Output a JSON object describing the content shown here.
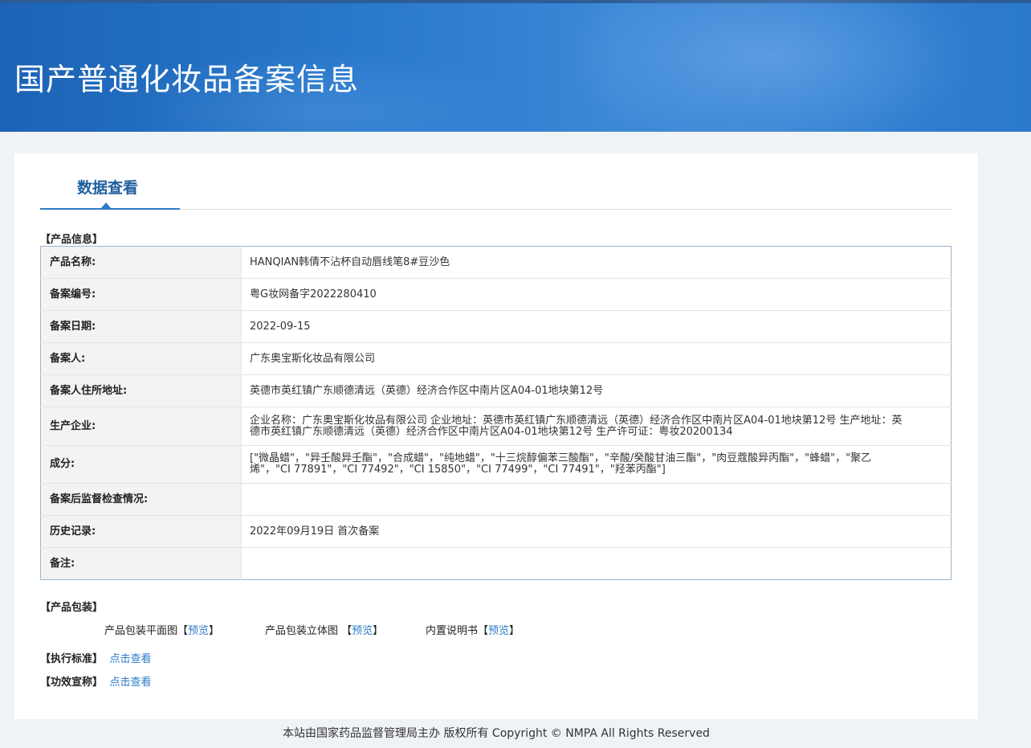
{
  "header": {
    "title": "国产普通化妆品备案信息"
  },
  "tab": {
    "label": "数据查看"
  },
  "product_info": {
    "section_title": "【产品信息】",
    "rows": [
      {
        "label": "产品名称:",
        "value": "HANQIAN韩倩不沾杯自动唇线笔8#豆沙色"
      },
      {
        "label": "备案编号:",
        "value": "粤G妆网备字2022280410"
      },
      {
        "label": "备案日期:",
        "value": "2022-09-15"
      },
      {
        "label": "备案人:",
        "value": "广东奥宝斯化妆品有限公司"
      },
      {
        "label": "备案人住所地址:",
        "value": "英德市英红镇广东顺德清远（英德）经济合作区中南片区A04-01地块第12号"
      },
      {
        "label": "生产企业:",
        "value": "企业名称：广东奥宝斯化妆品有限公司 企业地址：英德市英红镇广东顺德清远（英德）经济合作区中南片区A04-01地块第12号 生产地址：英德市英红镇广东顺德清远（英德）经济合作区中南片区A04-01地块第12号 生产许可证：粤妆20200134"
      },
      {
        "label": "成分:",
        "value": "[\"微晶蜡\"，\"异壬酸异壬酯\"，\"合成蜡\"，\"纯地蜡\"，\"十三烷醇偏苯三酸酯\"，\"辛酸/癸酸甘油三酯\"，\"肉豆蔻酸异丙酯\"，\"蜂蜡\"，\"聚乙烯\"，\"CI 77891\"，\"CI 77492\"，\"CI 15850\"，\"CI 77499\"，\"CI 77491\"，\"羟苯丙酯\"]"
      },
      {
        "label": "备案后监督检查情况:",
        "value": ""
      },
      {
        "label": "历史记录:",
        "value": "2022年09月19日 首次备案"
      },
      {
        "label": "备注:",
        "value": ""
      }
    ]
  },
  "packaging": {
    "section_title": "【产品包装】",
    "items": [
      {
        "label": "产品包装平面图",
        "open": "【",
        "link": "预览",
        "close": "】"
      },
      {
        "label": "产品包装立体图 ",
        "open": "【",
        "link": "预览",
        "close": "】"
      },
      {
        "label": "内置说明书",
        "open": "【",
        "link": "预览",
        "close": "】"
      }
    ]
  },
  "standard": {
    "section_title": "【执行标准】",
    "link": "点击查看"
  },
  "efficacy": {
    "section_title": "【功效宣称】",
    "link": "点击查看"
  },
  "footer": {
    "text": "本站由国家药品监督管理局主办 版权所有 Copyright © NMPA All Rights Reserved"
  },
  "colors": {
    "header_blue": "#2878cc",
    "link_blue": "#2b7bc8",
    "tab_text": "#1f5f9f"
  }
}
